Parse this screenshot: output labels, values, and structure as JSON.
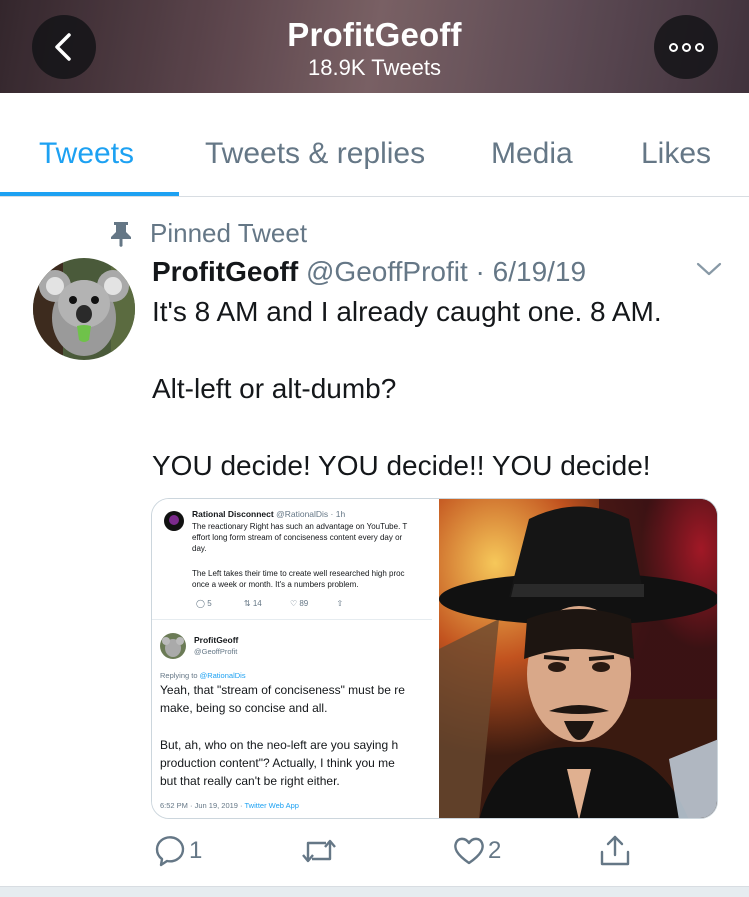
{
  "header": {
    "title": "ProfitGeoff",
    "subtitle": "18.9K Tweets"
  },
  "tabs": [
    {
      "label": "Tweets",
      "active": true
    },
    {
      "label": "Tweets & replies",
      "active": false
    },
    {
      "label": "Media",
      "active": false
    },
    {
      "label": "Likes",
      "active": false
    }
  ],
  "tweet": {
    "pinned_label": "Pinned Tweet",
    "name": "ProfitGeoff",
    "handle": "@GeoffProfit",
    "separator": " · ",
    "date": "6/19/19",
    "text": "It's 8 AM and I already caught one. 8 AM.\n\nAlt-left or alt-dumb?\n\nYOU decide! YOU decide!! YOU decide!",
    "embedded_screenshot": {
      "top_author": "Rational Disconnect",
      "top_handle_time": "@RationalDis · 1h",
      "top_text_lines": [
        "The reactionary Right has such an advantage on YouTube. T",
        "effort long form stream of conciseness content every day or",
        "day.",
        "The Left takes their time to create well researched high proc",
        "once a week or month. It's a numbers problem."
      ],
      "top_counts": {
        "replies": "5",
        "retweets": "14",
        "likes": "89"
      },
      "reply_author": "ProfitGeoff",
      "reply_handle": "@GeoffProfit",
      "replying_to_prefix": "Replying to ",
      "replying_to_handle": "@RationalDis",
      "reply_lines": [
        "Yeah, that \"stream of conciseness\" must be re",
        "make, being so concise and all.",
        "But, ah, who on the neo-left are you saying h",
        "production content\"? Actually, I think you me",
        "but that really can't be right either."
      ],
      "footer_time": "6:52 PM · Jun 19, 2019 · ",
      "footer_app": "Twitter Web App"
    },
    "actions": {
      "replies": "1",
      "retweets": "",
      "likes": "2"
    }
  },
  "colors": {
    "accent": "#1da1f2",
    "muted": "#657786",
    "text": "#14171a"
  },
  "icons": [
    "back-arrow-icon",
    "more-options-icon",
    "pin-icon",
    "chevron-down-icon",
    "reply-icon",
    "retweet-icon",
    "like-icon",
    "share-icon"
  ]
}
